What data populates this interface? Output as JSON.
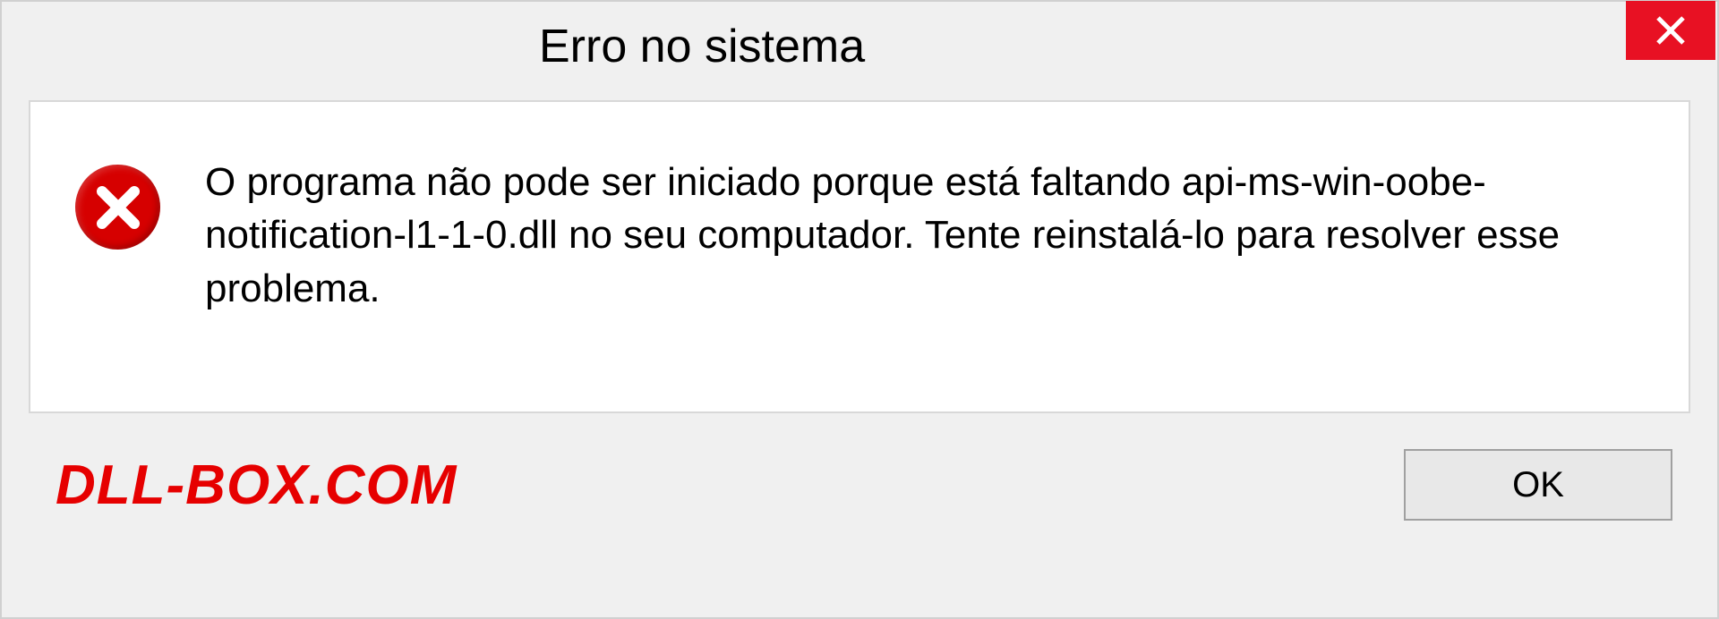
{
  "dialog": {
    "title": "Erro no sistema",
    "message": "O programa não pode ser iniciado porque está faltando api-ms-win-oobe-notification-l1-1-0.dll no seu computador. Tente reinstalá-lo para resolver esse problema.",
    "ok_label": "OK"
  },
  "watermark": "DLL-BOX.COM",
  "colors": {
    "close_button_bg": "#e81123",
    "error_icon_bg": "#d60000",
    "watermark_color": "#e60000"
  }
}
